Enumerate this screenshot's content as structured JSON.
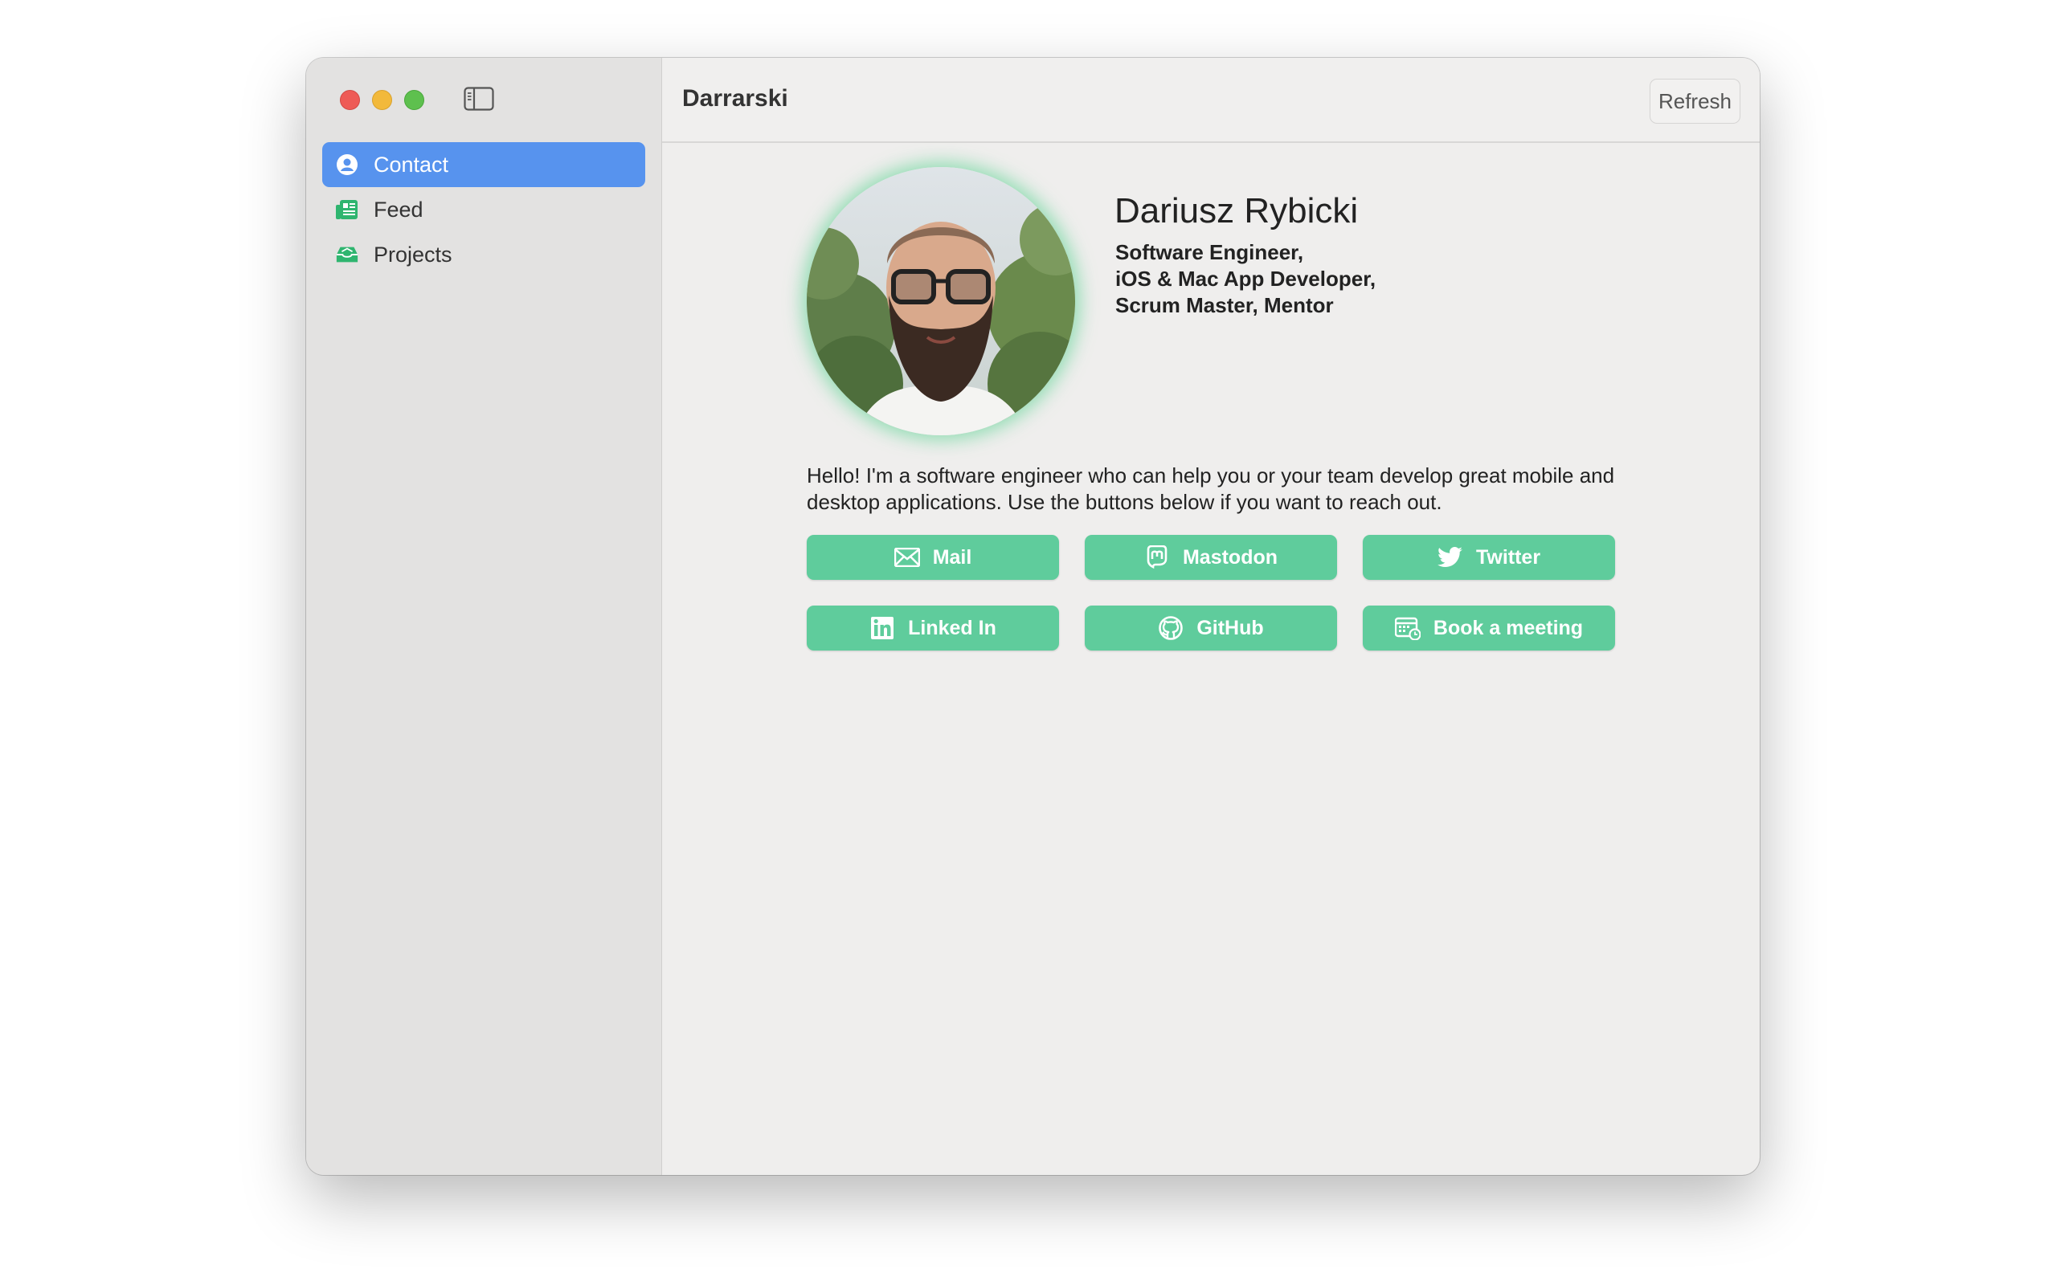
{
  "window": {
    "title": "Darrarski",
    "refresh_label": "Refresh"
  },
  "sidebar": {
    "items": [
      {
        "label": "Contact",
        "icon": "person-circle-icon",
        "active": true
      },
      {
        "label": "Feed",
        "icon": "newspaper-icon",
        "active": false
      },
      {
        "label": "Projects",
        "icon": "tray-icon",
        "active": false
      }
    ]
  },
  "profile": {
    "name": "Dariusz Rybicki",
    "roles": [
      "Software Engineer,",
      "iOS & Mac App Developer,",
      "Scrum Master, Mentor"
    ],
    "bio": "Hello! I'm a software engineer who can help you or your team develop great mobile and desktop applications. Use the buttons below if you want to reach out."
  },
  "buttons": [
    {
      "label": "Mail",
      "icon": "envelope-icon"
    },
    {
      "label": "Mastodon",
      "icon": "mastodon-icon"
    },
    {
      "label": "Twitter",
      "icon": "twitter-bird-icon"
    },
    {
      "label": "Linked In",
      "icon": "linkedin-icon"
    },
    {
      "label": "GitHub",
      "icon": "github-icon"
    },
    {
      "label": "Book a meeting",
      "icon": "calendar-icon"
    }
  ],
  "colors": {
    "accent": "#5793ee",
    "button_green": "#5fcc9c",
    "sidebar_icon_green": "#2fb56f"
  }
}
